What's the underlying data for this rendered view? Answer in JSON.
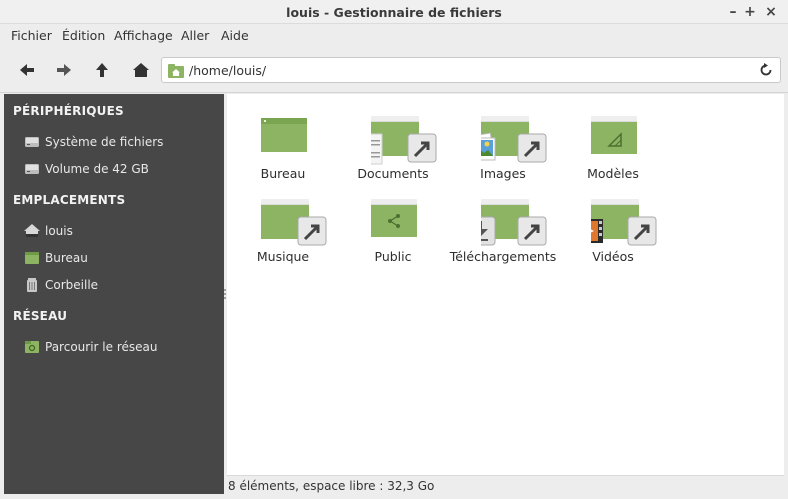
{
  "window": {
    "title": "louis - Gestionnaire de fichiers",
    "minimize_glyph": "–",
    "maximize_glyph": "+",
    "close_glyph": "×"
  },
  "menu": [
    "Fichier",
    "Édition",
    "Affichage",
    "Aller",
    "Aide"
  ],
  "toolbar": {
    "back_icon": "arrow-left-icon",
    "forward_icon": "arrow-right-icon",
    "up_icon": "arrow-up-icon",
    "home_icon": "home-icon",
    "path": "/home/louis/",
    "reload_icon": "reload-icon"
  },
  "sidebar": {
    "sections": [
      {
        "title": "PÉRIPHÉRIQUES",
        "items": [
          {
            "label": "Système de fichiers",
            "icon": "drive-icon"
          },
          {
            "label": "Volume de 42 GB",
            "icon": "drive-icon"
          }
        ]
      },
      {
        "title": "EMPLACEMENTS",
        "items": [
          {
            "label": "louis",
            "icon": "home-icon"
          },
          {
            "label": "Bureau",
            "icon": "folder-icon"
          },
          {
            "label": "Corbeille",
            "icon": "trash-icon"
          }
        ]
      },
      {
        "title": "RÉSEAU",
        "items": [
          {
            "label": "Parcourir le réseau",
            "icon": "network-folder-icon"
          }
        ]
      }
    ]
  },
  "files": [
    {
      "label": "Bureau",
      "icon": "desktop-folder-icon",
      "symlink": false
    },
    {
      "label": "Documents",
      "icon": "documents-folder-icon",
      "symlink": true
    },
    {
      "label": "Images",
      "icon": "pictures-folder-icon",
      "symlink": true
    },
    {
      "label": "Modèles",
      "icon": "templates-folder-icon",
      "symlink": false
    },
    {
      "label": "Musique",
      "icon": "music-folder-icon",
      "symlink": true
    },
    {
      "label": "Public",
      "icon": "public-folder-icon",
      "symlink": false
    },
    {
      "label": "Téléchargements",
      "icon": "downloads-folder-icon",
      "symlink": true
    },
    {
      "label": "Vidéos",
      "icon": "videos-folder-icon",
      "symlink": true
    }
  ],
  "status": "8 éléments, espace libre : 32,3 Go",
  "colors": {
    "folder_green": "#8cb463",
    "folder_green_dark": "#6f9a45",
    "sidebar_bg": "#474747"
  }
}
